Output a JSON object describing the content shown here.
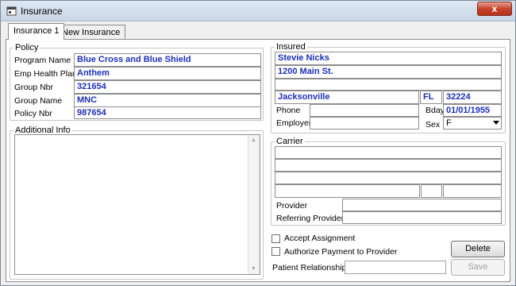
{
  "window": {
    "title": "Insurance",
    "close_label": "x"
  },
  "tabs": [
    {
      "label": "Insurance 1",
      "active": true
    },
    {
      "label": "New Insurance",
      "active": false
    }
  ],
  "policy": {
    "legend": "Policy",
    "program_name_label": "Program Name",
    "program_name": "Blue Cross and Blue Shield",
    "emp_health_plan_label": "Emp Health Plan",
    "emp_health_plan": "Anthem",
    "group_nbr_label": "Group Nbr",
    "group_nbr": "321654",
    "group_name_label": "Group Name",
    "group_name": "MNC",
    "policy_nbr_label": "Policy Nbr",
    "policy_nbr": "987654"
  },
  "additional_info": {
    "legend": "Additional Info",
    "value": ""
  },
  "insured": {
    "legend": "Insured",
    "name": "Stevie Nicks",
    "address": "1200 Main St.",
    "city": "Jacksonville",
    "state": "FL",
    "zip": "32224",
    "phone_label": "Phone",
    "bday_label": "Bday",
    "bday": "01/01/1955",
    "employer_label": "Employer",
    "sex_label": "Sex",
    "sex": "F"
  },
  "carrier": {
    "legend": "Carrier",
    "provider_label": "Provider",
    "referring_provider_label": "Referring Provider"
  },
  "options": {
    "accept_assignment": "Accept Assignment",
    "authorize_payment": "Authorize Payment to Provider",
    "patient_relationship_label": "Patient Relationship"
  },
  "buttons": {
    "delete": "Delete",
    "save": "Save"
  },
  "colors": {
    "value_text": "#1b2fb8",
    "close_button": "#c7432c"
  }
}
